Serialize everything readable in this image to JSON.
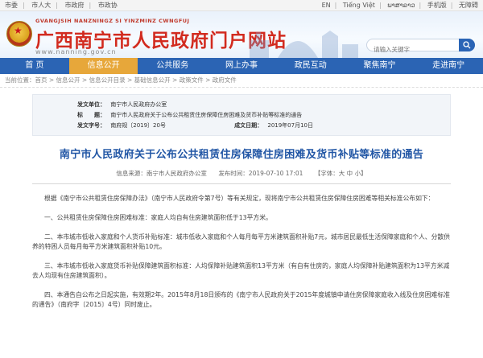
{
  "topbar": {
    "left": [
      "市委",
      "市人大",
      "市政府",
      "市政协"
    ],
    "right": [
      "EN",
      "Tiếng Việt",
      "ພາສາລາວ",
      "手机版",
      "无障碍"
    ]
  },
  "header": {
    "pinyin": "GVANGJSIH NANZNINGZ SI YINZMINZ CWNGFUJ",
    "title": "广西南宁市人民政府门户网站",
    "url": "www.nanning.gov.cn",
    "search_placeholder": "请输入关键字"
  },
  "nav": [
    "首 页",
    "信息公开",
    "公共服务",
    "网上办事",
    "政民互动",
    "聚焦南宁",
    "走进南宁"
  ],
  "nav_active": 1,
  "breadcrumb": "当前位置：首页 > 信息公开 > 信息公开目录 > 基础信息公开 > 政策文件 > 政府文件",
  "meta": {
    "issuer_label": "发文单位：",
    "issuer": "南宁市人民政府办公室",
    "title_label": "标　　题：",
    "title": "南宁市人民政府关于公布公共租赁住房保障住房困难及货币补贴等标准的通告",
    "doc_no_label": "发文字号：",
    "doc_no": "南府规〔2019〕20号",
    "date_label": "成文日期：",
    "date": "2019年07月10日"
  },
  "article": {
    "title": "南宁市人民政府关于公布公共租赁住房保障住房困难及货币补贴等标准的通告",
    "source": "信息来源：南宁市人民政府办公室",
    "publish_time": "发布时间：2019-07-10 17:01",
    "font_size": "【字体：大 中 小】",
    "paragraphs": [
      "根据《南宁市公共租赁住房保障办法》（南宁市人民政府令第7号）等有关规定，现将南宁市公共租赁住房保障住房困难等相关标准公布如下：",
      "一、公共租赁住房保障住房困难标准：家庭人均自有住房建筑面积低于13平方米。",
      "二、本市城市低收入家庭和个人货币补贴标准：城市低收入家庭和个人每月每平方米建筑面积补贴7元，城市居民最低生活保障家庭和个人、分散供养的特困人员每月每平方米建筑面积补贴10元。",
      "三、本市城市低收入家庭货币补贴保障建筑面积标准：人均保障补贴建筑面积13平方米（有自有住房的，家庭人均保障补贴建筑面积为13平方米减去人均现有住房建筑面积）。",
      "四、本通告自公布之日起实施，有效期2年。2015年8月18日颁布的《南宁市人民政府关于2015年度城镇申请住房保障家庭收入线及住房困难标准的通告》（南府字〔2015〕4号）同时废止。"
    ]
  }
}
